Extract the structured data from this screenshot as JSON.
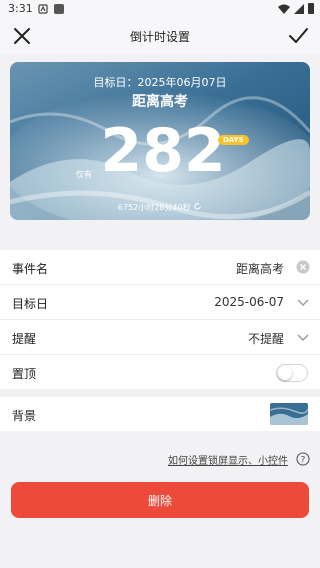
{
  "status_bar": {
    "time": "3:31"
  },
  "topbar": {
    "title": "倒计时设置"
  },
  "hero": {
    "target_date": "目标日：2025年06月07日",
    "event_name": "距离高考",
    "remaining_label": "仅有",
    "days": "282",
    "days_badge": "DAYS",
    "hours_text": "6752小时28分40秒"
  },
  "form": {
    "event": {
      "label": "事件名",
      "value": "距离高考"
    },
    "date": {
      "label": "目标日",
      "value": "2025-06-07"
    },
    "remind": {
      "label": "提醒",
      "value": "不提醒"
    },
    "pin": {
      "label": "置顶",
      "enabled": false
    }
  },
  "background": {
    "label": "背景"
  },
  "help_link": "如何设置锁屏显示、小控件",
  "delete_label": "删除",
  "colors": {
    "delete": "#ee4a3a",
    "badge": "#f6c32a",
    "ocean": "#3a6f95"
  }
}
